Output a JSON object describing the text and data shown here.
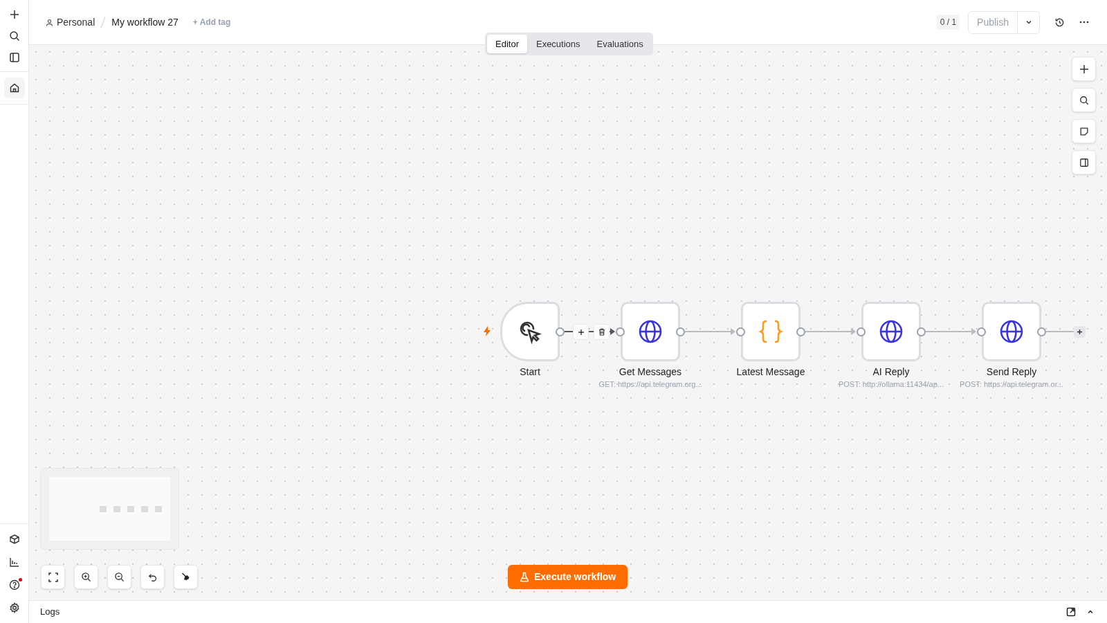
{
  "breadcrumb": {
    "project": "Personal",
    "workflow": "My workflow 27",
    "add_tag": "+ Add tag"
  },
  "header": {
    "counter": "0 / 1",
    "publish": "Publish"
  },
  "tabs": [
    {
      "label": "Editor",
      "selected": true
    },
    {
      "label": "Executions",
      "selected": false
    },
    {
      "label": "Evaluations",
      "selected": false
    }
  ],
  "nodes": [
    {
      "kind": "trigger",
      "name": "Start"
    },
    {
      "kind": "http",
      "name": "Get Messages",
      "subtitle": "GET: https://api.telegram.org..."
    },
    {
      "kind": "code",
      "name": "Latest Message"
    },
    {
      "kind": "http",
      "name": "AI Reply",
      "subtitle": "POST: http://ollama:11434/ap..."
    },
    {
      "kind": "http",
      "name": "Send Reply",
      "subtitle": "POST: https://api.telegram.or..."
    }
  ],
  "help_notification": true,
  "execute_button": "Execute workflow",
  "logs": {
    "title": "Logs"
  }
}
